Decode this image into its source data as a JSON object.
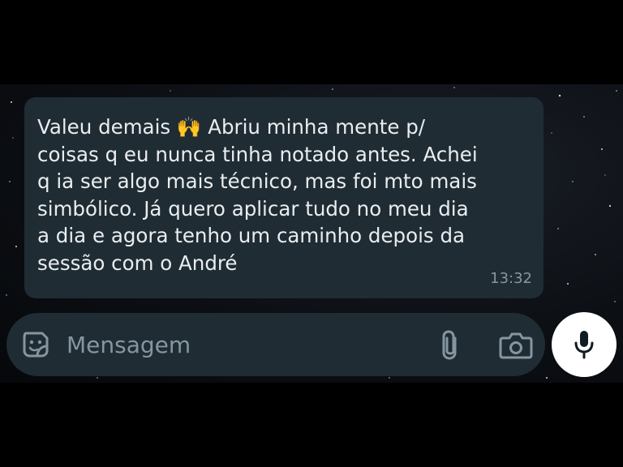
{
  "message": {
    "text": "Valeu demais 🙌 Abriu minha mente p/\ncoisas q eu nunca tinha notado antes. Achei\nq ia ser algo mais técnico, mas foi mto mais\nsimbólico. Já quero aplicar tudo no meu dia\na dia e agora tenho um caminho depois da\nsessão com o André",
    "time": "13:32"
  },
  "composer": {
    "placeholder": "Mensagem",
    "value": "",
    "left_icon": "sticker-icon",
    "attach_icon": "paperclip-icon",
    "camera_icon": "camera-icon",
    "send_icon": "microphone-icon"
  },
  "colors": {
    "bubble": "#202c33",
    "input_bar": "#1f2c34",
    "text": "#e9edef",
    "muted": "#8696a0",
    "mic_button": "#ffffff"
  }
}
